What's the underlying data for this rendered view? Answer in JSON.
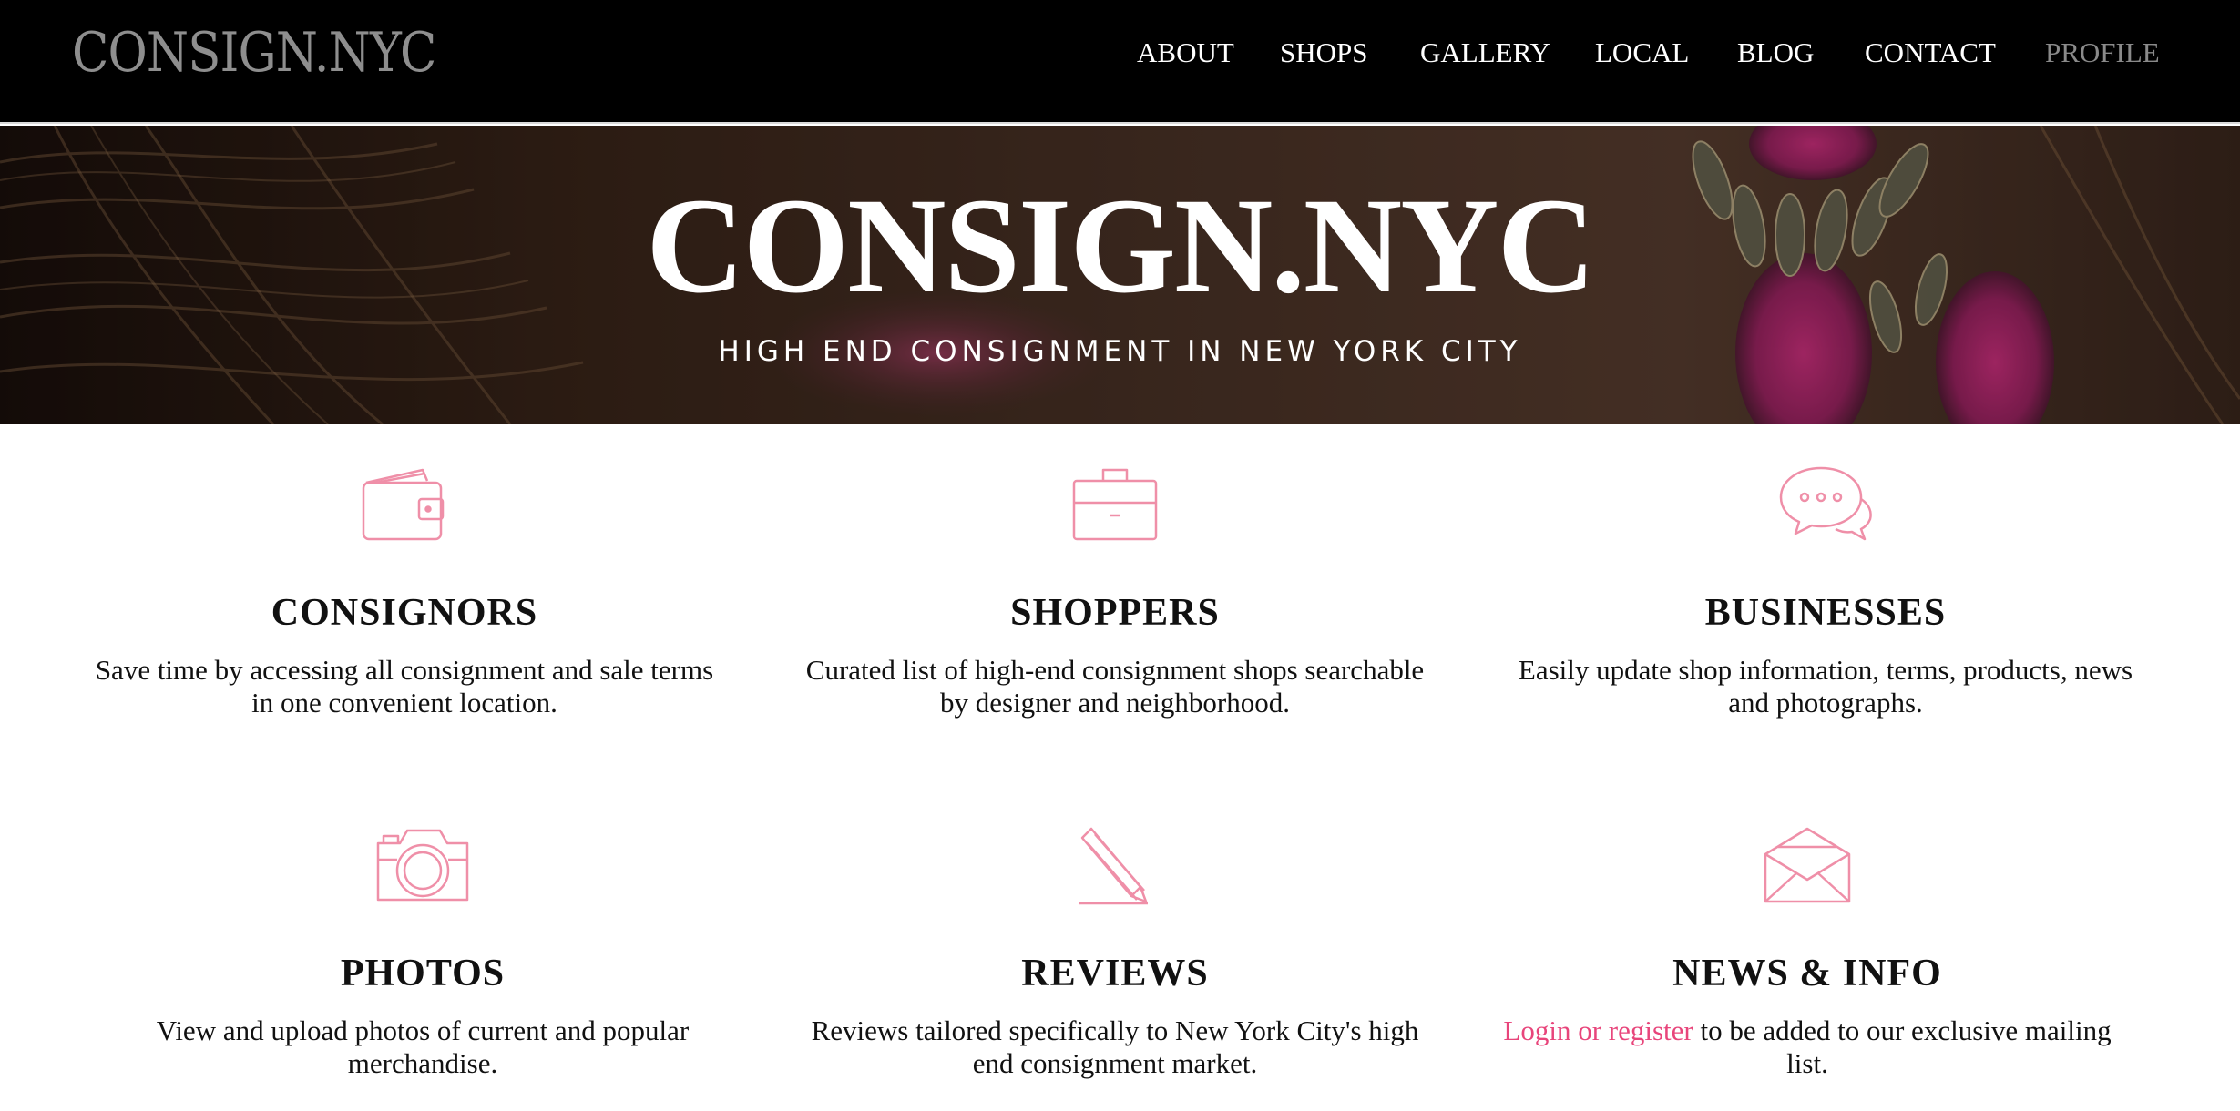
{
  "brand": {
    "name": "CONSIGN.NYC"
  },
  "nav": {
    "items": [
      {
        "label": "ABOUT"
      },
      {
        "label": "SHOPS"
      },
      {
        "label": "GALLERY"
      },
      {
        "label": "LOCAL"
      },
      {
        "label": "BLOG"
      },
      {
        "label": "CONTACT"
      },
      {
        "label": "PROFILE"
      }
    ]
  },
  "hero": {
    "title": "CONSIGN.NYC",
    "subtitle": "HIGH END CONSIGNMENT IN NEW YORK CITY"
  },
  "features": [
    {
      "icon": "wallet-icon",
      "title": "CONSIGNORS",
      "text": "Save time by accessing all consignment and sale terms in one convenient location."
    },
    {
      "icon": "briefcase-icon",
      "title": "SHOPPERS",
      "text": "Curated list of high-end consignment shops searchable by designer and neighborhood."
    },
    {
      "icon": "chat-bubbles-icon",
      "title": "BUSINESSES",
      "text": "Easily update shop information, terms, products, news and photographs."
    },
    {
      "icon": "camera-icon",
      "title": "PHOTOS",
      "text": "View and upload photos of current and popular merchandise."
    },
    {
      "icon": "pencil-icon",
      "title": "REVIEWS",
      "text": "Reviews tailored specifically to New York City's high end consignment market."
    },
    {
      "icon": "envelope-icon",
      "title": "NEWS & INFO",
      "link_text": "Login or register",
      "text": " to be added to our exclusive mailing list."
    }
  ],
  "colors": {
    "accent": "#e8457b",
    "icon_stroke": "#ef8fa8",
    "navbar_bg": "#000000",
    "brand_muted": "#8e8e8e"
  }
}
